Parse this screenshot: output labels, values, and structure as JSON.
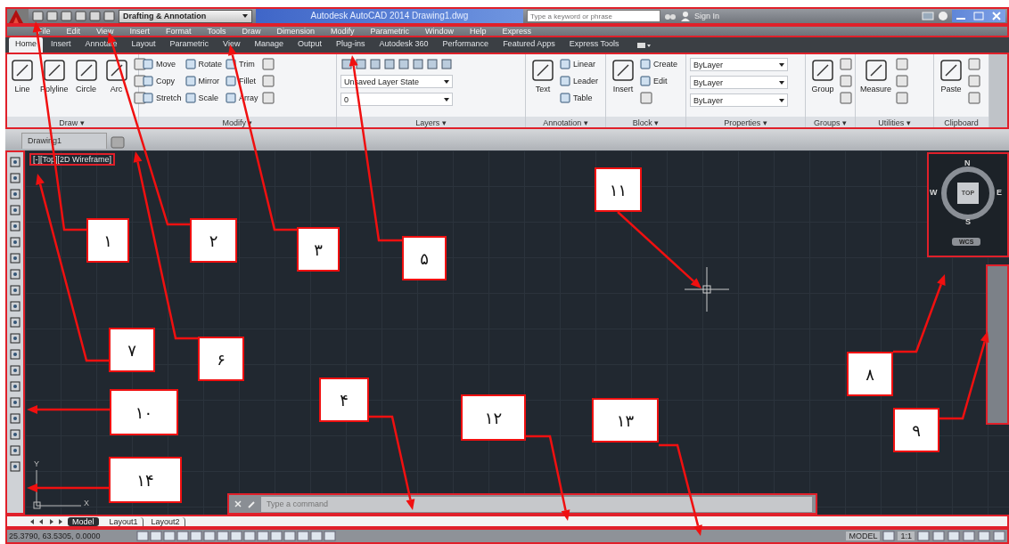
{
  "title_bar": {
    "workspace": "Drafting & Annotation",
    "title": "Autodesk AutoCAD 2014   Drawing1.dwg",
    "search": {
      "placeholder": "Type a keyword or phrase"
    },
    "sign_in": "Sign In"
  },
  "menu_bar": [
    "File",
    "Edit",
    "View",
    "Insert",
    "Format",
    "Tools",
    "Draw",
    "Dimension",
    "Modify",
    "Parametric",
    "Window",
    "Help",
    "Express"
  ],
  "ribbon_tabs": [
    {
      "label": "Home",
      "selected": true
    },
    {
      "label": "Insert",
      "selected": false
    },
    {
      "label": "Annotate",
      "selected": false
    },
    {
      "label": "Layout",
      "selected": false
    },
    {
      "label": "Parametric",
      "selected": false
    },
    {
      "label": "View",
      "selected": false
    },
    {
      "label": "Manage",
      "selected": false
    },
    {
      "label": "Output",
      "selected": false
    },
    {
      "label": "Plug-ins",
      "selected": false
    },
    {
      "label": "Autodesk 360",
      "selected": false
    },
    {
      "label": "Performance",
      "selected": false
    },
    {
      "label": "Featured Apps",
      "selected": false
    },
    {
      "label": "Express Tools",
      "selected": false
    }
  ],
  "ribbon_panels": [
    {
      "title": "Draw ▾",
      "groups": [
        {
          "kind": "large",
          "label": "Line"
        },
        {
          "kind": "large",
          "label": "Polyline"
        },
        {
          "kind": "large",
          "label": "Circle"
        },
        {
          "kind": "large",
          "label": "Arc"
        },
        {
          "kind": "stack",
          "items": [
            {
              "kind": "tool"
            },
            {
              "kind": "tool"
            },
            {
              "kind": "tool"
            }
          ]
        }
      ]
    },
    {
      "title": "Modify ▾",
      "groups": [
        {
          "kind": "stack",
          "items": [
            {
              "kind": "tool",
              "label": "Move"
            },
            {
              "kind": "tool",
              "label": "Copy"
            },
            {
              "kind": "tool",
              "label": "Stretch"
            }
          ]
        },
        {
          "kind": "stack",
          "items": [
            {
              "kind": "tool",
              "label": "Rotate"
            },
            {
              "kind": "tool",
              "label": "Mirror"
            },
            {
              "kind": "tool",
              "label": "Scale"
            }
          ]
        },
        {
          "kind": "stack",
          "items": [
            {
              "kind": "tool",
              "label": "Trim"
            },
            {
              "kind": "tool",
              "label": "Fillet"
            },
            {
              "kind": "tool",
              "label": "Array"
            }
          ]
        },
        {
          "kind": "stack",
          "items": [
            {
              "kind": "tool"
            },
            {
              "kind": "tool"
            },
            {
              "kind": "tool"
            }
          ]
        }
      ]
    },
    {
      "title": "Layers ▾",
      "groups": [
        {
          "kind": "stack",
          "items": [
            {
              "kind": "iconrow"
            },
            {
              "kind": "combo",
              "label": "Unsaved Layer State"
            },
            {
              "kind": "combo",
              "label": "0"
            }
          ]
        }
      ]
    },
    {
      "title": "Annotation ▾",
      "groups": [
        {
          "kind": "large",
          "label": "Text"
        },
        {
          "kind": "stack",
          "items": [
            {
              "kind": "tool",
              "label": "Linear"
            },
            {
              "kind": "tool",
              "label": "Leader"
            },
            {
              "kind": "tool",
              "label": "Table"
            }
          ]
        }
      ]
    },
    {
      "title": "Block ▾",
      "groups": [
        {
          "kind": "large",
          "label": "Insert"
        },
        {
          "kind": "stack",
          "items": [
            {
              "kind": "tool",
              "label": "Create"
            },
            {
              "kind": "tool",
              "label": "Edit"
            },
            {
              "kind": "tool"
            }
          ]
        }
      ]
    },
    {
      "title": "Properties ▾",
      "groups": [
        {
          "kind": "stack",
          "items": [
            {
              "kind": "combo",
              "label": "ByLayer"
            },
            {
              "kind": "combo",
              "label": "ByLayer"
            },
            {
              "kind": "combo",
              "label": "ByLayer"
            }
          ]
        }
      ]
    },
    {
      "title": "Groups ▾",
      "groups": [
        {
          "kind": "large",
          "label": "Group"
        },
        {
          "kind": "stack",
          "items": [
            {
              "kind": "tool"
            },
            {
              "kind": "tool"
            },
            {
              "kind": "tool"
            }
          ]
        }
      ]
    },
    {
      "title": "Utilities ▾",
      "groups": [
        {
          "kind": "large",
          "label": "Measure"
        },
        {
          "kind": "stack",
          "items": [
            {
              "kind": "tool"
            },
            {
              "kind": "tool"
            },
            {
              "kind": "tool"
            }
          ]
        }
      ]
    },
    {
      "title": "Clipboard",
      "groups": [
        {
          "kind": "large",
          "label": "Paste"
        },
        {
          "kind": "stack",
          "items": [
            {
              "kind": "tool"
            },
            {
              "kind": "tool"
            },
            {
              "kind": "tool"
            }
          ]
        }
      ]
    }
  ],
  "document_tab": "Drawing1",
  "viewport_label": "[-][Top][2D Wireframe]",
  "view_cube": {
    "north": "N",
    "west": "W",
    "east": "E",
    "south": "S",
    "face": "TOP",
    "ucs": "WCS"
  },
  "ucs_icon": {
    "y": "Y",
    "x": "X"
  },
  "command_line": {
    "placeholder": "Type a command"
  },
  "layout_tabs": [
    {
      "kind": "model",
      "label": "Model",
      "selected": true
    },
    {
      "kind": "layout",
      "label": "Layout1",
      "selected": false
    },
    {
      "kind": "layout",
      "label": "Layout2",
      "selected": false
    }
  ],
  "status_bar": {
    "coordinates": "25.3790, 63.5305, 0.0000",
    "space": "MODEL",
    "scale": "1:1"
  },
  "callouts": [
    {
      "label": "۱"
    },
    {
      "label": "۲"
    },
    {
      "label": "۳"
    },
    {
      "label": "۵"
    },
    {
      "label": "۱۱"
    },
    {
      "label": "۷"
    },
    {
      "label": "۶"
    },
    {
      "label": "۸"
    },
    {
      "label": "۱۰"
    },
    {
      "label": "۴"
    },
    {
      "label": "۱۳"
    },
    {
      "label": "۱۲"
    },
    {
      "label": "۹"
    },
    {
      "label": "۱۴"
    }
  ]
}
